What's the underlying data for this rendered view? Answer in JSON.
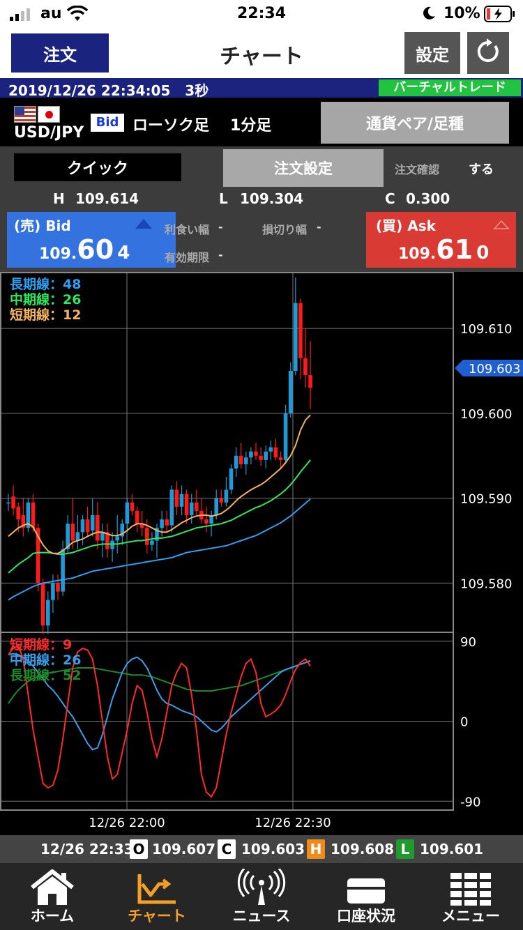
{
  "status": {
    "carrier": "au",
    "time": "22:34",
    "battery": "10%"
  },
  "header": {
    "order_btn": "注文",
    "title": "チャート",
    "settings_btn": "設定"
  },
  "datebar": {
    "datetime": "2019/12/26 22:34:05",
    "interval": "3秒",
    "virtual_trade": "バーチャルトレード"
  },
  "pair": {
    "name": "USD/JPY",
    "bid_tag": "Bid",
    "chart_type": "ローソク足",
    "timeframe": "1分足",
    "pair_btn": "通貨ペア/足種"
  },
  "order": {
    "quick_btn": "クイック",
    "order_settings_btn": "注文設定",
    "confirm_label": "注文確認",
    "confirm_value": "する",
    "high_label": "H",
    "high": "109.614",
    "low_label": "L",
    "low": "109.304",
    "close_label": "C",
    "close": "0.300",
    "bid_label": "(売) Bid",
    "bid_small": "109.",
    "bid_big": "60",
    "bid_last": "4",
    "ask_label": "(買) Ask",
    "ask_small": "109.",
    "ask_big": "61",
    "ask_last": "0",
    "take_profit_label": "利食い幅",
    "take_profit": "-",
    "stop_loss_label": "損切り幅",
    "stop_loss": "-",
    "expiry_label": "有効期限",
    "expiry": "-"
  },
  "chart_data": [
    {
      "type": "candlestick",
      "legend": [
        "長期線：48",
        "中期線：26",
        "短期線：12"
      ],
      "y_ticks": [
        "109.610",
        "109.600",
        "109.590",
        "109.580"
      ],
      "ylim": [
        109.5742,
        109.6165
      ],
      "current_price": "109.603",
      "x_ticks": [
        "12/26 22:00",
        "12/26 22:30"
      ],
      "candles": [
        {
          "o": 109.5895,
          "h": 109.5905,
          "l": 109.5885,
          "c": 109.5895
        },
        {
          "o": 109.5902,
          "h": 109.5915,
          "l": 109.588,
          "c": 109.5888
        },
        {
          "o": 109.589,
          "h": 109.5895,
          "l": 109.586,
          "c": 109.5875
        },
        {
          "o": 109.588,
          "h": 109.59,
          "l": 109.5855,
          "c": 109.5865
        },
        {
          "o": 109.5865,
          "h": 109.59,
          "l": 109.586,
          "c": 109.5895
        },
        {
          "o": 109.5895,
          "h": 109.5905,
          "l": 109.586,
          "c": 109.5865
        },
        {
          "o": 109.5865,
          "h": 109.587,
          "l": 109.579,
          "c": 109.58
        },
        {
          "o": 109.58,
          "h": 109.5805,
          "l": 109.574,
          "c": 109.575
        },
        {
          "o": 109.575,
          "h": 109.579,
          "l": 109.574,
          "c": 109.578
        },
        {
          "o": 109.578,
          "h": 109.581,
          "l": 109.5765,
          "c": 109.58
        },
        {
          "o": 109.58,
          "h": 109.581,
          "l": 109.578,
          "c": 109.579
        },
        {
          "o": 109.579,
          "h": 109.585,
          "l": 109.5785,
          "c": 109.584
        },
        {
          "o": 109.584,
          "h": 109.588,
          "l": 109.5835,
          "c": 109.587
        },
        {
          "o": 109.587,
          "h": 109.59,
          "l": 109.584,
          "c": 109.585
        },
        {
          "o": 109.585,
          "h": 109.588,
          "l": 109.584,
          "c": 109.586
        },
        {
          "o": 109.586,
          "h": 109.588,
          "l": 109.5845,
          "c": 109.5875
        },
        {
          "o": 109.5875,
          "h": 109.589,
          "l": 109.5855,
          "c": 109.586
        },
        {
          "o": 109.5862,
          "h": 109.59,
          "l": 109.5855,
          "c": 109.588
        },
        {
          "o": 109.588,
          "h": 109.5895,
          "l": 109.584,
          "c": 109.585
        },
        {
          "o": 109.585,
          "h": 109.587,
          "l": 109.583,
          "c": 109.586
        },
        {
          "o": 109.586,
          "h": 109.587,
          "l": 109.583,
          "c": 109.584
        },
        {
          "o": 109.584,
          "h": 109.586,
          "l": 109.5825,
          "c": 109.585
        },
        {
          "o": 109.585,
          "h": 109.588,
          "l": 109.5835,
          "c": 109.5855
        },
        {
          "o": 109.5855,
          "h": 109.5875,
          "l": 109.5845,
          "c": 109.587
        },
        {
          "o": 109.587,
          "h": 109.59,
          "l": 109.586,
          "c": 109.5895
        },
        {
          "o": 109.5895,
          "h": 109.5905,
          "l": 109.588,
          "c": 109.5885
        },
        {
          "o": 109.5885,
          "h": 109.589,
          "l": 109.586,
          "c": 109.587
        },
        {
          "o": 109.587,
          "h": 109.5885,
          "l": 109.5855,
          "c": 109.5865
        },
        {
          "o": 109.5865,
          "h": 109.5875,
          "l": 109.5835,
          "c": 109.5845
        },
        {
          "o": 109.5845,
          "h": 109.586,
          "l": 109.5838,
          "c": 109.585
        },
        {
          "o": 109.585,
          "h": 109.587,
          "l": 109.583,
          "c": 109.5865
        },
        {
          "o": 109.5865,
          "h": 109.5885,
          "l": 109.5855,
          "c": 109.5875
        },
        {
          "o": 109.5875,
          "h": 109.5885,
          "l": 109.586,
          "c": 109.5868
        },
        {
          "o": 109.5868,
          "h": 109.5915,
          "l": 109.586,
          "c": 109.591
        },
        {
          "o": 109.591,
          "h": 109.592,
          "l": 109.588,
          "c": 109.589
        },
        {
          "o": 109.589,
          "h": 109.5915,
          "l": 109.588,
          "c": 109.5905
        },
        {
          "o": 109.5905,
          "h": 109.591,
          "l": 109.587,
          "c": 109.588
        },
        {
          "o": 109.588,
          "h": 109.5905,
          "l": 109.587,
          "c": 109.5895
        },
        {
          "o": 109.5895,
          "h": 109.591,
          "l": 109.588,
          "c": 109.5885
        },
        {
          "o": 109.5885,
          "h": 109.59,
          "l": 109.587,
          "c": 109.5875
        },
        {
          "o": 109.5875,
          "h": 109.589,
          "l": 109.586,
          "c": 109.587
        },
        {
          "o": 109.587,
          "h": 109.5885,
          "l": 109.5855,
          "c": 109.588
        },
        {
          "o": 109.588,
          "h": 109.591,
          "l": 109.5875,
          "c": 109.59
        },
        {
          "o": 109.59,
          "h": 109.591,
          "l": 109.589,
          "c": 109.5895
        },
        {
          "o": 109.5895,
          "h": 109.5925,
          "l": 109.589,
          "c": 109.591
        },
        {
          "o": 109.591,
          "h": 109.594,
          "l": 109.5905,
          "c": 109.5935
        },
        {
          "o": 109.5935,
          "h": 109.596,
          "l": 109.5925,
          "c": 109.595
        },
        {
          "o": 109.595,
          "h": 109.5965,
          "l": 109.5935,
          "c": 109.594
        },
        {
          "o": 109.594,
          "h": 109.5955,
          "l": 109.5928,
          "c": 109.5948
        },
        {
          "o": 109.5948,
          "h": 109.596,
          "l": 109.594,
          "c": 109.5955
        },
        {
          "o": 109.5955,
          "h": 109.5965,
          "l": 109.5945,
          "c": 109.595
        },
        {
          "o": 109.595,
          "h": 109.596,
          "l": 109.5938,
          "c": 109.5945
        },
        {
          "o": 109.5945,
          "h": 109.5962,
          "l": 109.5935,
          "c": 109.5955
        },
        {
          "o": 109.5955,
          "h": 109.5968,
          "l": 109.5945,
          "c": 109.596
        },
        {
          "o": 109.596,
          "h": 109.597,
          "l": 109.5945,
          "c": 109.5948
        },
        {
          "o": 109.5948,
          "h": 109.5955,
          "l": 109.5935,
          "c": 109.5945
        },
        {
          "o": 109.5945,
          "h": 109.601,
          "l": 109.594,
          "c": 109.6
        },
        {
          "o": 109.6,
          "h": 109.606,
          "l": 109.5995,
          "c": 109.605
        },
        {
          "o": 109.605,
          "h": 109.616,
          "l": 109.6045,
          "c": 109.613
        },
        {
          "o": 109.613,
          "h": 109.6135,
          "l": 109.604,
          "c": 109.6065
        },
        {
          "o": 109.6065,
          "h": 109.61,
          "l": 109.603,
          "c": 109.6045
        },
        {
          "o": 109.6045,
          "h": 109.6085,
          "l": 109.6005,
          "c": 109.603
        }
      ],
      "short_ma": [
        109.5855,
        109.586,
        109.5865,
        109.5868,
        109.587,
        109.5866,
        109.5855,
        109.5845,
        109.5838,
        109.5835,
        109.5835,
        109.5838,
        109.5843,
        109.5848,
        109.585,
        109.5852,
        109.5855,
        109.5858,
        109.586,
        109.586,
        109.5858,
        109.5856,
        109.5856,
        109.5858,
        109.5862,
        109.5867,
        109.587,
        109.587,
        109.5868,
        109.5865,
        109.5862,
        109.586,
        109.586,
        109.5863,
        109.5867,
        109.5871,
        109.5874,
        109.5877,
        109.5879,
        109.588,
        109.588,
        109.5879,
        109.588,
        109.5882,
        109.5886,
        109.5891,
        109.5897,
        109.5902,
        109.5906,
        109.591,
        109.5913,
        109.5916,
        109.592,
        109.5925,
        109.593,
        109.5935,
        109.5942,
        109.595,
        109.5962,
        109.598,
        109.5992,
        109.5998
      ],
      "mid_ma": [
        109.5812,
        109.5817,
        109.5822,
        109.5826,
        109.583,
        109.5835,
        109.5836,
        109.5836,
        109.5836,
        109.5835,
        109.5834,
        109.5834,
        109.5835,
        109.5836,
        109.5838,
        109.584,
        109.5842,
        109.5844,
        109.5845,
        109.5846,
        109.5846,
        109.5846,
        109.5846,
        109.5847,
        109.5848,
        109.5849,
        109.585,
        109.585,
        109.5851,
        109.5852,
        109.5853,
        109.5853,
        109.5854,
        109.5855,
        109.5857,
        109.5859,
        109.5861,
        109.5863,
        109.5865,
        109.5866,
        109.5867,
        109.5868,
        109.5869,
        109.587,
        109.5872,
        109.5874,
        109.5877,
        109.588,
        109.5883,
        109.5886,
        109.5889,
        109.5891,
        109.5894,
        109.5897,
        109.5901,
        109.5905,
        109.591,
        109.5916,
        109.5923,
        109.5931,
        109.5938,
        109.5945
      ],
      "long_ma": [
        109.578,
        109.5784,
        109.5787,
        109.579,
        109.5793,
        109.5796,
        109.5798,
        109.58,
        109.5801,
        109.5802,
        109.5803,
        109.5804,
        109.5805,
        109.5806,
        109.5808,
        109.581,
        109.5812,
        109.5814,
        109.5815,
        109.5816,
        109.5817,
        109.5818,
        109.5819,
        109.582,
        109.5821,
        109.5822,
        109.5823,
        109.5824,
        109.5825,
        109.5826,
        109.5827,
        109.5828,
        109.5829,
        109.583,
        109.5832,
        109.5834,
        109.5836,
        109.5837,
        109.5838,
        109.5839,
        109.584,
        109.5841,
        109.5842,
        109.5843,
        109.5844,
        109.5846,
        109.5848,
        109.585,
        109.5852,
        109.5854,
        109.5856,
        109.5859,
        109.5862,
        109.5865,
        109.5868,
        109.5871,
        109.5875,
        109.5879,
        109.5884,
        109.5889,
        109.5894,
        109.5899
      ]
    },
    {
      "type": "line",
      "legend": [
        "短期線：9",
        "中期線：26",
        "長期線：52"
      ],
      "y_ticks": [
        "90",
        "0",
        "-90"
      ],
      "ylim": [
        -100,
        100
      ],
      "series": [
        {
          "name": "短期線：9",
          "color": "#ff2a2a",
          "values": [
            75,
            82,
            85,
            70,
            30,
            -10,
            -40,
            -70,
            -75,
            -72,
            -55,
            -20,
            20,
            60,
            78,
            82,
            80,
            70,
            40,
            0,
            -40,
            -65,
            -60,
            -35,
            -10,
            20,
            40,
            35,
            10,
            -20,
            -40,
            -20,
            10,
            40,
            55,
            65,
            60,
            30,
            -10,
            -60,
            -80,
            -85,
            -75,
            -45,
            -15,
            10,
            30,
            50,
            65,
            70,
            55,
            20,
            5,
            8,
            12,
            18,
            30,
            45,
            58,
            66,
            70,
            62
          ]
        },
        {
          "name": "中期線：26",
          "color": "#3a9ee8",
          "values": [
            75,
            76,
            75,
            72,
            68,
            62,
            55,
            48,
            40,
            35,
            28,
            20,
            12,
            5,
            -5,
            -15,
            -25,
            -32,
            -30,
            -15,
            5,
            25,
            40,
            55,
            65,
            70,
            72,
            68,
            60,
            48,
            35,
            25,
            20,
            18,
            15,
            12,
            10,
            8,
            5,
            0,
            -5,
            -10,
            -12,
            -8,
            -2,
            5,
            10,
            15,
            20,
            25,
            30,
            35,
            40,
            45,
            50,
            55,
            58,
            60,
            62,
            64,
            66,
            68
          ]
        },
        {
          "name": "長期線：52",
          "color": "#1e8a2a",
          "values": [
            20,
            28,
            35,
            40,
            45,
            48,
            50,
            52,
            54,
            55,
            56,
            57,
            58,
            59,
            60,
            60,
            60,
            60,
            59,
            58,
            57,
            56,
            55,
            54,
            53,
            52,
            52,
            52,
            51,
            50,
            48,
            46,
            44,
            42,
            40,
            38,
            36,
            35,
            34,
            34,
            34,
            34,
            35,
            36,
            37,
            38,
            39,
            40,
            42,
            44,
            46,
            48,
            50,
            52,
            54,
            56,
            58,
            60,
            62,
            64,
            66,
            68
          ]
        }
      ]
    }
  ],
  "infobar": {
    "time": "12/26 22:33",
    "open_label": "O",
    "open": "109.607",
    "close_label": "C",
    "close": "109.603",
    "high_label": "H",
    "high": "109.608",
    "low_label": "L",
    "low": "109.601"
  },
  "nav": [
    {
      "label": "ホーム",
      "icon": "home-icon"
    },
    {
      "label": "チャート",
      "icon": "chart-icon"
    },
    {
      "label": "ニュース",
      "icon": "news-icon"
    },
    {
      "label": "口座状況",
      "icon": "account-icon"
    },
    {
      "label": "メニュー",
      "icon": "menu-icon"
    }
  ],
  "colors": {
    "bid": "#3472e0",
    "ask": "#d93a34",
    "up": "#1e9bd7",
    "down": "#ff1a1a",
    "short_ma": "#f5b461",
    "mid_ma": "#2ee85e",
    "long_ma": "#2f9ff2"
  }
}
